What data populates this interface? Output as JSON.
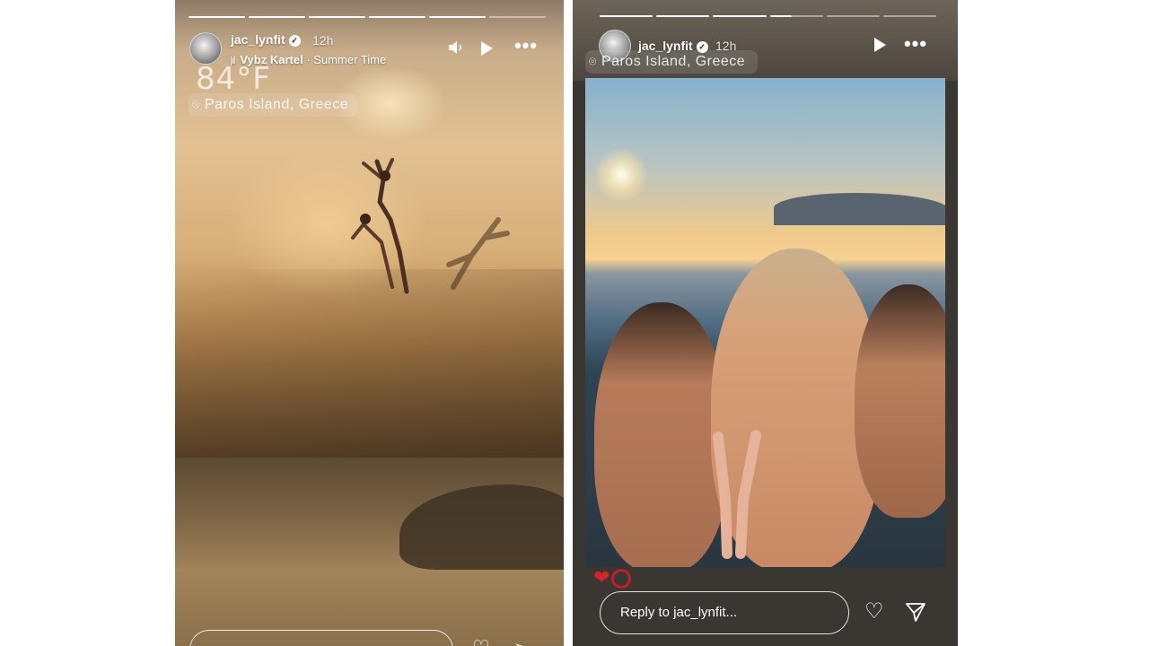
{
  "left_story": {
    "username": "jac_lynfit",
    "verified_icon": "verified-badge-icon",
    "time_ago": "12h",
    "music": {
      "artist": "Vybz Kartel",
      "separator": "·",
      "track": "Summer Time"
    },
    "temperature": "84°F",
    "location": "Paros Island, Greece",
    "progress": {
      "segments": 6,
      "completed": 5
    }
  },
  "right_story": {
    "username": "jac_lynfit",
    "time_ago": "12h",
    "location": "Paros Island, Greece",
    "progress": {
      "segments": 6,
      "completed": 3,
      "current_fraction": 0.4
    },
    "reactions": [
      "❤",
      "ring"
    ],
    "reply_placeholder": "Reply to jac_lynfit..."
  },
  "icons": {
    "mute": "speaker-icon",
    "play": "play-icon",
    "more": "more-options-icon",
    "like": "heart-icon",
    "share": "send-icon",
    "location": "location-pin-icon"
  }
}
